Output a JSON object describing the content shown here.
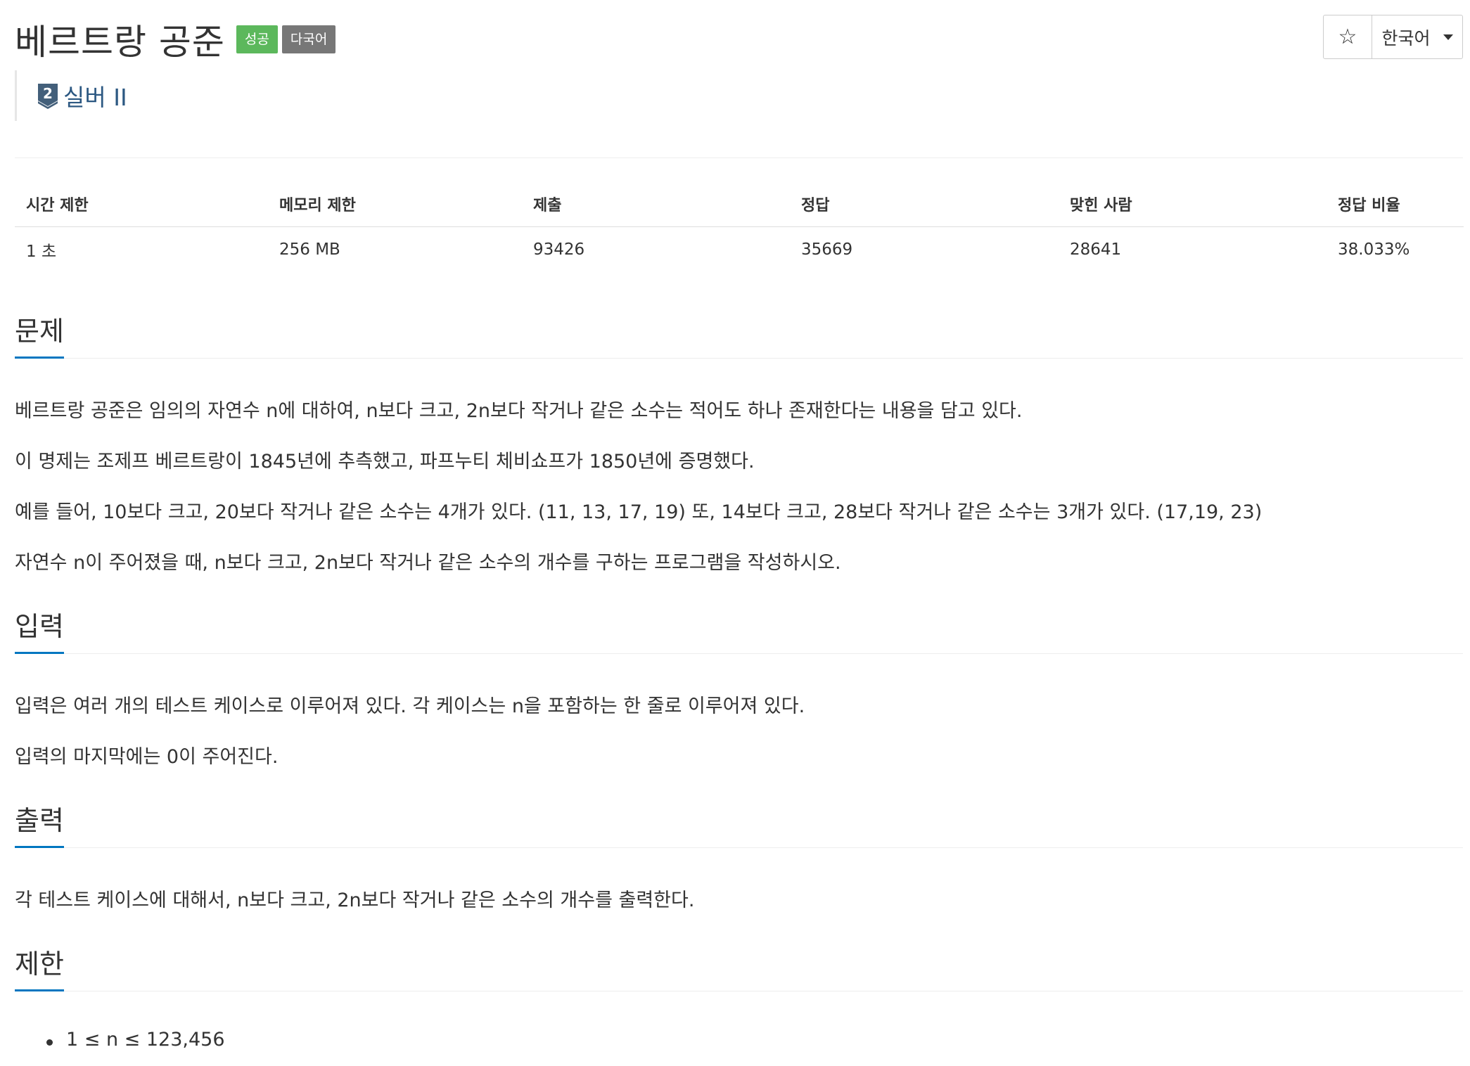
{
  "header": {
    "title": "베르트랑 공준",
    "labels": [
      {
        "text": "성공",
        "color": "#5cb85c"
      },
      {
        "text": "다국어",
        "color": "#777777"
      }
    ],
    "tier": {
      "icon": "silver-2-tier-icon",
      "number": "2",
      "text": "실버 II",
      "color": "#2c5882"
    }
  },
  "toolbar": {
    "star_icon": "☆",
    "language": "한국어"
  },
  "stats": {
    "headers": [
      "시간 제한",
      "메모리 제한",
      "제출",
      "정답",
      "맞힌 사람",
      "정답 비율"
    ],
    "values": [
      "1 초",
      "256 MB",
      "93426",
      "35669",
      "28641",
      "38.033%"
    ]
  },
  "sections": {
    "problem": {
      "title": "문제",
      "paragraphs": [
        "베르트랑 공준은 임의의 자연수 n에 대하여, n보다 크고, 2n보다 작거나 같은 소수는 적어도 하나 존재한다는 내용을 담고 있다.",
        "이 명제는 조제프 베르트랑이 1845년에 추측했고, 파프누티 체비쇼프가 1850년에 증명했다.",
        "예를 들어, 10보다 크고, 20보다 작거나 같은 소수는 4개가 있다. (11, 13, 17, 19) 또, 14보다 크고, 28보다 작거나 같은 소수는 3개가 있다. (17,19, 23)",
        "자연수 n이 주어졌을 때, n보다 크고, 2n보다 작거나 같은 소수의 개수를 구하는 프로그램을 작성하시오."
      ]
    },
    "input": {
      "title": "입력",
      "paragraphs": [
        "입력은 여러 개의 테스트 케이스로 이루어져 있다. 각 케이스는 n을 포함하는 한 줄로 이루어져 있다.",
        "입력의 마지막에는 0이 주어진다."
      ]
    },
    "output": {
      "title": "출력",
      "paragraphs": [
        "각 테스트 케이스에 대해서, n보다 크고, 2n보다 작거나 같은 소수의 개수를 출력한다."
      ]
    },
    "limit": {
      "title": "제한",
      "items": [
        "1 ≤ n ≤ 123,456"
      ]
    }
  },
  "colors": {
    "accent": "#0076c0",
    "tier": "#2c5882",
    "success": "#5cb85c",
    "neutral": "#777777"
  }
}
